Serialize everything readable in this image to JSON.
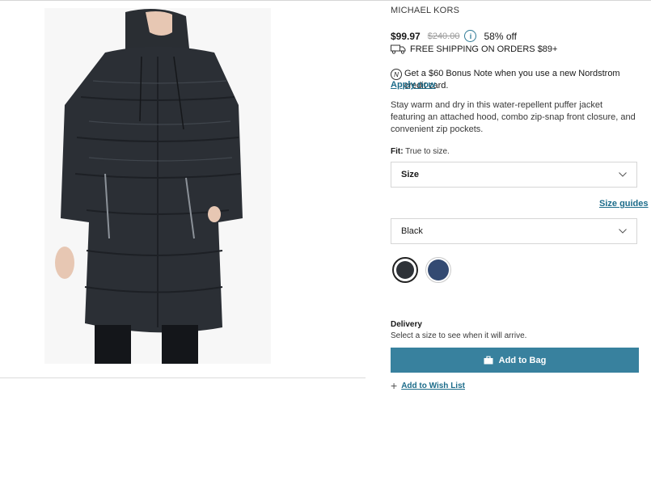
{
  "product": {
    "brand": "MICHAEL KORS",
    "image_alt": "Woman wearing a long black hooded puffer jacket",
    "description": "Stay warm and dry in this water-repellent puffer jacket featuring an attached hood, combo zip-snap front closure, and convenient zip pockets."
  },
  "price": {
    "sale": "$99.97",
    "original": "$240.00",
    "discount": "58% off",
    "info_icon": "info-icon"
  },
  "shipping": {
    "text": "FREE SHIPPING ON ORDERS $89+",
    "icon": "truck-icon"
  },
  "promo": {
    "text": "Get a $60 Bonus Note when you use a new Nordstrom credit card.",
    "link": "Apply now",
    "icon": "nordstrom-card-icon"
  },
  "fit": {
    "label": "Fit:",
    "value": "True to size."
  },
  "size_select": {
    "value": "Size"
  },
  "size_guides": "Size guides",
  "color_select": {
    "value": "Black"
  },
  "swatches": [
    {
      "name": "Black",
      "color": "#2e3238",
      "selected": true
    },
    {
      "name": "Navy",
      "color": "#334a72",
      "selected": false
    }
  ],
  "delivery": {
    "title": "Delivery",
    "subtitle": "Select a size to see when it will arrive."
  },
  "actions": {
    "add_to_bag": "Add to Bag",
    "wish_list": "Add to Wish List"
  },
  "colors": {
    "accent": "#38819e",
    "link": "#1c6c8a"
  }
}
